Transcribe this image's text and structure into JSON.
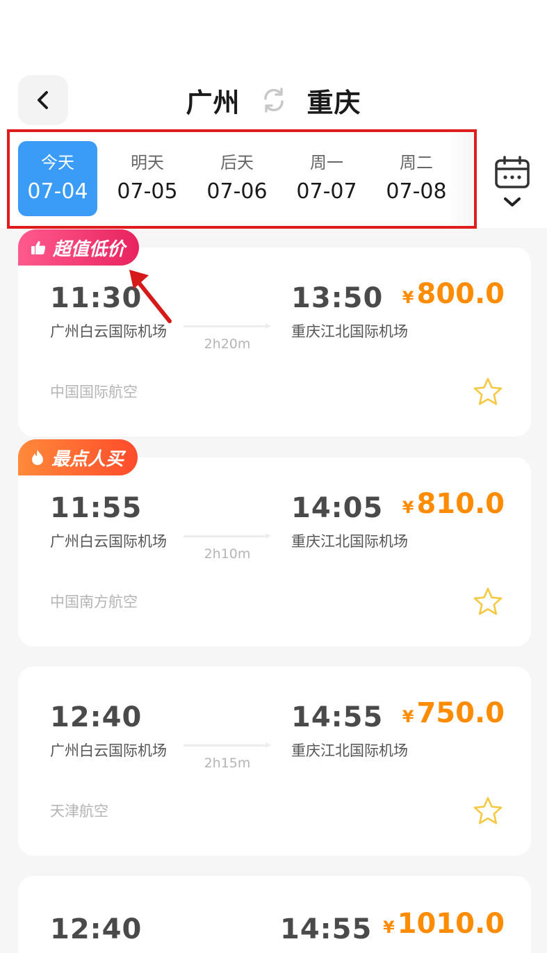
{
  "header": {
    "from_city": "广州",
    "to_city": "重庆"
  },
  "dates": [
    {
      "weekday": "今天",
      "date": "07-04",
      "active": true
    },
    {
      "weekday": "明天",
      "date": "07-05",
      "active": false
    },
    {
      "weekday": "后天",
      "date": "07-06",
      "active": false
    },
    {
      "weekday": "周一",
      "date": "07-07",
      "active": false
    },
    {
      "weekday": "周二",
      "date": "07-08",
      "active": false
    }
  ],
  "flights": [
    {
      "badge": "超值低价",
      "dep_time": "11:30",
      "dep_airport": "广州白云国际机场",
      "arr_time": "13:50",
      "arr_airport": "重庆江北国际机场",
      "duration": "2h20m",
      "airline": "中国国际航空",
      "currency": "¥",
      "price": "800.0"
    },
    {
      "badge": "最点人买",
      "dep_time": "11:55",
      "dep_airport": "广州白云国际机场",
      "arr_time": "14:05",
      "arr_airport": "重庆江北国际机场",
      "duration": "2h10m",
      "airline": "中国南方航空",
      "currency": "¥",
      "price": "810.0"
    },
    {
      "badge": "",
      "dep_time": "12:40",
      "dep_airport": "广州白云国际机场",
      "arr_time": "14:55",
      "arr_airport": "重庆江北国际机场",
      "duration": "2h15m",
      "airline": "天津航空",
      "currency": "¥",
      "price": "750.0"
    },
    {
      "badge": "",
      "dep_time": "12:40",
      "dep_airport": "",
      "arr_time": "14:55",
      "arr_airport": "",
      "duration": "",
      "airline": "",
      "currency": "¥",
      "price": "1010.0"
    }
  ],
  "colors": {
    "accent_blue": "#3b9cf7",
    "price_orange": "#ff8b00",
    "highlight_red": "#e01d1d",
    "badge_pink": "#e8235f",
    "badge_orange": "#ff4b2b",
    "star_yellow": "#f5c842"
  },
  "icons": {
    "back": "chevron-left-icon",
    "swap": "swap-refresh-icon",
    "calendar": "calendar-icon",
    "expand": "chevron-down-icon",
    "favorite": "star-outline-icon",
    "badge_1": "thumbs-up-icon",
    "badge_2": "fire-icon"
  }
}
